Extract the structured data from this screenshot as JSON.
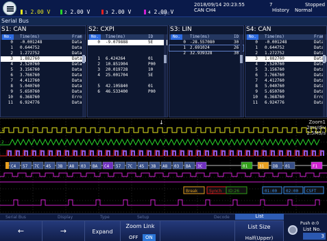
{
  "topbar": {
    "channels": [
      {
        "idx": "1",
        "value": "2.00 V",
        "color": "#e8e820"
      },
      {
        "idx": "2",
        "value": "2.00 V",
        "color": "#28d228"
      },
      {
        "idx": "3",
        "value": "2.00 V",
        "color": "#e82020"
      },
      {
        "idx": "4",
        "value": "2.00 V",
        "color": "#d020d0"
      }
    ],
    "logic_tag": "Logic",
    "date": "2018/09/14 20:23:55",
    "can_channel": "CAN CH4",
    "count": "7",
    "mode": "History",
    "state": "Stopped",
    "acq": "Normal"
  },
  "serial_bus_title": "Serial Bus",
  "panels": [
    {
      "title": "S1: CAN",
      "headers": [
        "No.",
        "Time(ms)",
        "Fram"
      ],
      "rows": [
        [
          "0",
          "-0.001248",
          "Data"
        ],
        [
          "1",
          "0.644752",
          "Data"
        ],
        [
          "2",
          "1.272752",
          "Data"
        ],
        [
          "3",
          "1.882760",
          "Data"
        ],
        [
          "4",
          "2.520760",
          "Data"
        ],
        [
          "5",
          "3.156760",
          "Data"
        ],
        [
          "6",
          "3.766760",
          "Data"
        ],
        [
          "7",
          "4.412760",
          "Data"
        ],
        [
          "8",
          "5.040760",
          "Data"
        ],
        [
          "9",
          "5.650760",
          "Data"
        ],
        [
          "10",
          "6.368760",
          "Erro"
        ],
        [
          "11",
          "6.924776",
          "Data"
        ]
      ],
      "selected": 3
    },
    {
      "title": "S2: CXPI",
      "headers": [
        "No.",
        "Time(ms)",
        "ID"
      ],
      "rows": [
        [
          "0",
          "-9.079888",
          "5E"
        ],
        [
          "",
          "",
          ""
        ],
        [
          "",
          "",
          ""
        ],
        [
          "1",
          "6.424264",
          "01"
        ],
        [
          "2",
          "10.851904",
          "P00"
        ],
        [
          "3",
          "20.019728",
          "10"
        ],
        [
          "4",
          "25.001704",
          "5E"
        ],
        [
          "",
          "",
          ""
        ],
        [
          "5",
          "42.105840",
          "01"
        ],
        [
          "6",
          "46.533400",
          "P00"
        ]
      ],
      "selected": 0
    },
    {
      "title": "S3: LIN",
      "headers": [
        "No.",
        "Time(ms)",
        "ID"
      ],
      "rows": [
        [
          "0",
          "-28.557080",
          "30"
        ],
        [
          "1",
          "2.691024",
          "26"
        ],
        [
          "2",
          "32.939328",
          "30"
        ]
      ],
      "selected": 1
    },
    {
      "title": "S4: CAN",
      "headers": [
        "No.",
        "Time(ms)",
        "Fram"
      ],
      "rows": [
        [
          "0",
          "-0.001248",
          "Data"
        ],
        [
          "1",
          "0.644752",
          "Data"
        ],
        [
          "2",
          "1.272752",
          "Data"
        ],
        [
          "3",
          "1.882760",
          "Data"
        ],
        [
          "4",
          "2.520760",
          "Data"
        ],
        [
          "5",
          "3.156760",
          "Data"
        ],
        [
          "6",
          "3.766760",
          "Data"
        ],
        [
          "7",
          "4.412760",
          "Data"
        ],
        [
          "8",
          "5.040760",
          "Data"
        ],
        [
          "9",
          "5.650760",
          "Data"
        ],
        [
          "10",
          "6.368760",
          "Erro"
        ],
        [
          "11",
          "6.924776",
          "Data"
        ]
      ],
      "selected": 3
    }
  ],
  "zoom": {
    "name": "Zoom1",
    "scale": "2ms/div",
    "rate": "2.5MS/s"
  },
  "decode_bytes": [
    "C4",
    "57",
    "7C",
    "45",
    "3B",
    "A8",
    "03",
    "BA",
    "C4",
    "57",
    "7C",
    "45",
    "3B",
    "A8",
    "03",
    "BA",
    "3C"
  ],
  "decode_right": [
    "01",
    "31",
    "DB",
    "01",
    "F1"
  ],
  "lin_events": [
    "Break",
    "Synch",
    "ID:26"
  ],
  "cxpi_events": [
    "01:00",
    "02:00",
    "CSFT"
  ],
  "softkeys": {
    "group_labels": [
      "Serial Bus",
      "Display",
      "Type",
      "Setup",
      "Decode",
      "List"
    ],
    "left_arrow": "←",
    "right_arrow": "→",
    "expand": "Expand",
    "zoom_link": "Zoom Link",
    "off": "OFF",
    "on": "ON",
    "list_size": "List Size",
    "half": "Half(Upper)",
    "push": "Push ⊘:0",
    "list_no": "List No.",
    "list_no_value": "3",
    "list_tab": "List"
  }
}
